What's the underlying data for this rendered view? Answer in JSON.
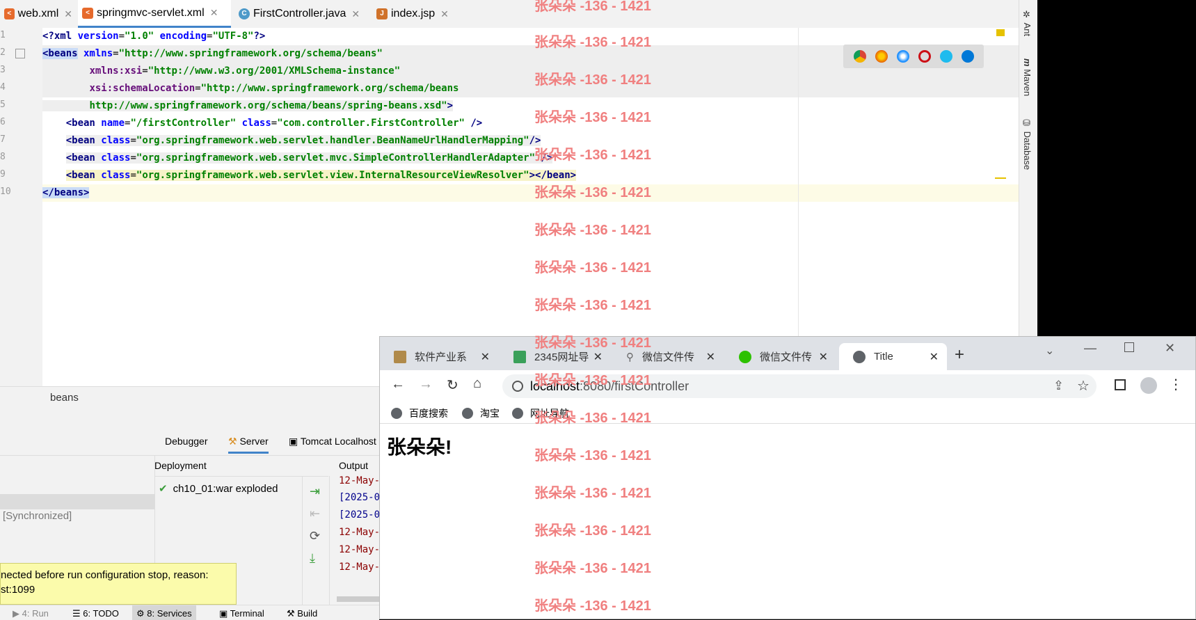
{
  "ide": {
    "tabs": [
      {
        "label": "web.xml",
        "active": false
      },
      {
        "label": "springmvc-servlet.xml",
        "active": true
      },
      {
        "label": "FirstController.java",
        "active": false
      },
      {
        "label": "index.jsp",
        "active": false
      }
    ],
    "line_numbers": [
      "1",
      "2",
      "3",
      "4",
      "5",
      "6",
      "7",
      "8",
      "9",
      "10"
    ],
    "code": {
      "l1": {
        "a": "<?",
        "b": "xml ",
        "c": "version",
        "d": "=",
        "e": "\"1.0\"",
        "f": " encoding",
        "g": "=",
        "h": "\"UTF-8\"",
        "i": "?>"
      },
      "l2": {
        "tag": "<beans",
        "att": " xmlns",
        "eq": "=",
        "str": "\"http://www.springframework.org/schema/beans\""
      },
      "l3": {
        "ns": "xmlns:xsi",
        "eq": "=",
        "str": "\"http://www.w3.org/2001/XMLSchema-instance\""
      },
      "l4": {
        "ns": "xsi:schemaLocation",
        "eq": "=",
        "str": "\"http://www.springframework.org/schema/beans"
      },
      "l5": {
        "str": "http://www.springframework.org/schema/beans/spring-beans.xsd\"",
        "tag": ">"
      },
      "l6": {
        "tag": "<bean",
        "att1": " name",
        "eq": "=",
        "str1": "\"/firstController\"",
        "att2": " class",
        "str2": "\"com.controller.FirstController\"",
        "end": " />"
      },
      "l7": {
        "tag": "<bean",
        "att": " class",
        "eq": "=",
        "str": "\"org.springframework.web.servlet.handler.BeanNameUrlHandlerMapping\"",
        "end": "/>"
      },
      "l8": {
        "tag": "<bean",
        "att": " class",
        "eq": "=",
        "str": "\"org.springframework.web.servlet.mvc.SimpleControllerHandlerAdapter\"",
        "end": " />"
      },
      "l9": {
        "tag": "<bean",
        "att": " class",
        "eq": "=",
        "str": "\"org.springframework.web.servlet.view.InternalResourceViewResolver\"",
        "end": "></bean>"
      },
      "l10": {
        "tag": "</beans>"
      }
    },
    "breadcrumb": "beans",
    "right_sidebar": [
      "Ant",
      "Maven",
      "Database"
    ]
  },
  "services": {
    "tabs": [
      "Debugger",
      "Server",
      "Tomcat Localhost"
    ],
    "deployment_header": "Deployment",
    "output_header": "Output",
    "deployment_item": "ch10_01:war exploded",
    "synchronized": "[Synchronized]",
    "output_lines": [
      "12-May-",
      "[2025-0",
      "[2025-0",
      "12-May-",
      "12-May-",
      "12-May-"
    ],
    "tooltip_line1": "nected before run configuration stop, reason:",
    "tooltip_line2": "st:1099",
    "bottom_tabs": [
      "4: Run",
      "6: TODO",
      "8: Services",
      "Terminal",
      "Build"
    ]
  },
  "browser": {
    "tabs": [
      {
        "label": "软件产业系"
      },
      {
        "label": "2345网址导"
      },
      {
        "label": "微信文件传"
      },
      {
        "label": "微信文件传"
      },
      {
        "label": "Title"
      }
    ],
    "url_host": "localhost",
    "url_rest": ":8080/firstController",
    "bookmarks": [
      "百度搜索",
      "淘宝",
      "网址导航"
    ],
    "page_heading": "张朵朵!"
  },
  "watermark": "张朵朵 -136 - 1421"
}
